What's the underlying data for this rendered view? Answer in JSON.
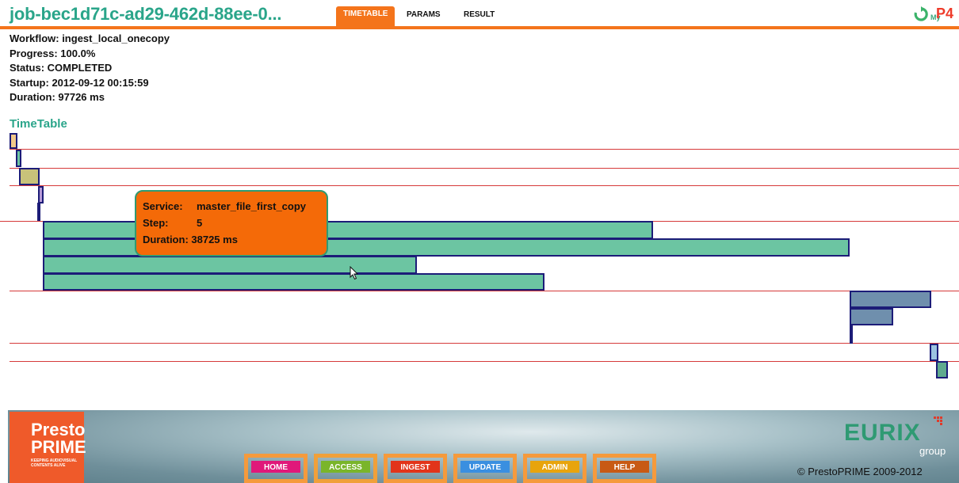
{
  "header": {
    "job_title": "job-bec1d71c-ad29-462d-88ee-0...",
    "tabs": [
      {
        "label": "TIMETABLE",
        "active": true
      },
      {
        "label": "PARAMS",
        "active": false
      },
      {
        "label": "RESULT",
        "active": false
      }
    ],
    "brand_my": "My",
    "brand_p4": "P4",
    "refresh_icon": "refresh-icon"
  },
  "info": {
    "workflow": "Workflow: ingest_local_onecopy",
    "progress": "Progress: 100.0%",
    "status": "Status: COMPLETED",
    "startup": "Startup: 2012-09-12 00:15:59",
    "duration": "Duration: 97726 ms"
  },
  "timetable": {
    "title": "TimeTable",
    "tooltip": {
      "service_label": "Service:",
      "service_value": "master_file_first_copy",
      "step_label": "Step:",
      "step_value": "5",
      "duration_text": "Duration: 38725 ms"
    }
  },
  "footer": {
    "logo_line1": "Presto",
    "logo_line2": "PRIME",
    "logo_tagline": "KEEPING AUDIOVISUAL CONTENTS ALIVE",
    "nav": [
      {
        "label": "HOME",
        "color": "#e0187a"
      },
      {
        "label": "ACCESS",
        "color": "#7ab52a"
      },
      {
        "label": "INGEST",
        "color": "#e2341a"
      },
      {
        "label": "UPDATE",
        "color": "#3a8fe0"
      },
      {
        "label": "ADMIN",
        "color": "#e8a40c"
      },
      {
        "label": "HELP",
        "color": "#c85a14"
      }
    ],
    "eurix": "EURIX",
    "group": "group",
    "copyright": "© PrestoPRIME 2009-2012"
  },
  "colors": {
    "accent": "#f4741b",
    "teal": "#2aa58a",
    "rowline": "#d63a3a",
    "bar_border": "#1c1c78"
  }
}
